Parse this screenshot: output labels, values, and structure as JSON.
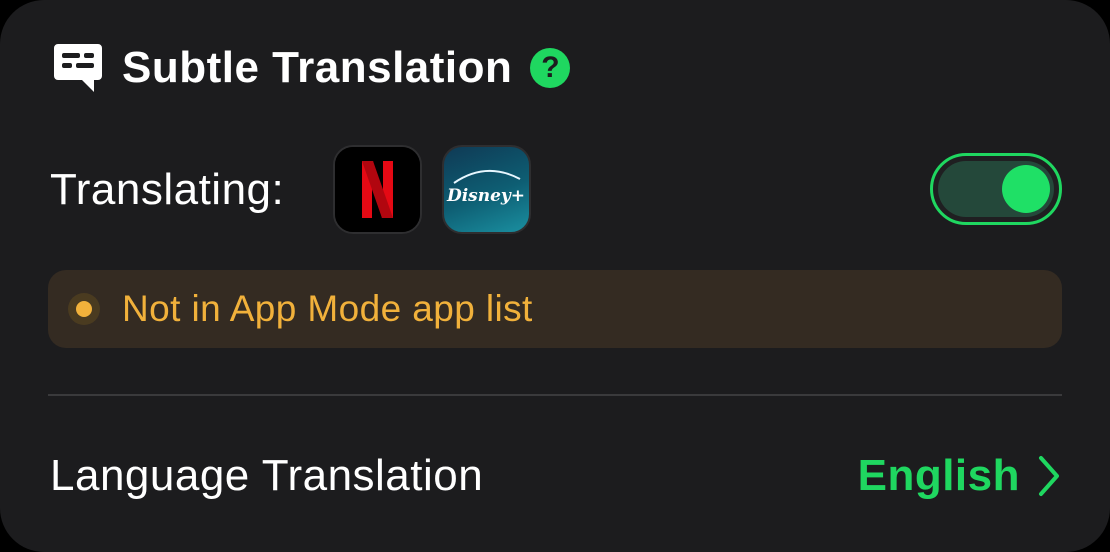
{
  "header": {
    "title": "Subtle Translation",
    "help_label": "?",
    "icon": "translation-bubble-icon"
  },
  "translating": {
    "label": "Translating:",
    "services": [
      {
        "name": "netflix",
        "glyph": "N",
        "icon": "netflix-icon"
      },
      {
        "name": "disney-plus",
        "glyph": "Disney+",
        "icon": "disney-plus-icon"
      }
    ],
    "enabled": true
  },
  "status": {
    "text": "Not in App Mode app list",
    "color": "#f1b13b"
  },
  "language": {
    "label": "Language Translation",
    "value": "English"
  },
  "colors": {
    "accent": "#1fd760",
    "warning": "#f1b13b",
    "background": "#1c1c1e"
  }
}
